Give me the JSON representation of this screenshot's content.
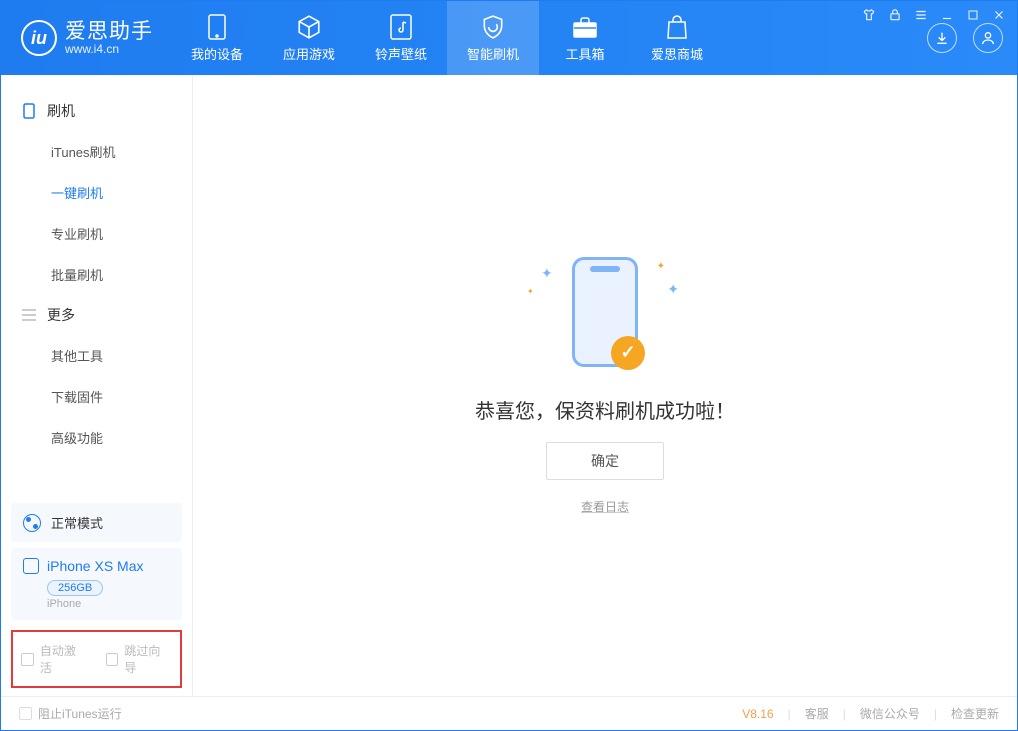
{
  "app": {
    "name_cn": "爱思助手",
    "name_en": "www.i4.cn"
  },
  "tabs": [
    {
      "label": "我的设备"
    },
    {
      "label": "应用游戏"
    },
    {
      "label": "铃声壁纸"
    },
    {
      "label": "智能刷机"
    },
    {
      "label": "工具箱"
    },
    {
      "label": "爱思商城"
    }
  ],
  "sidebar": {
    "group1_title": "刷机",
    "group1_items": [
      {
        "label": "iTunes刷机"
      },
      {
        "label": "一键刷机"
      },
      {
        "label": "专业刷机"
      },
      {
        "label": "批量刷机"
      }
    ],
    "group2_title": "更多",
    "group2_items": [
      {
        "label": "其他工具"
      },
      {
        "label": "下载固件"
      },
      {
        "label": "高级功能"
      }
    ],
    "mode_label": "正常模式",
    "device_name": "iPhone XS Max",
    "device_capacity": "256GB",
    "device_type": "iPhone",
    "opt_auto_activate": "自动激活",
    "opt_skip_guide": "跳过向导"
  },
  "main": {
    "success_text": "恭喜您，保资料刷机成功啦！",
    "ok_button": "确定",
    "view_log": "查看日志"
  },
  "footer": {
    "block_itunes": "阻止iTunes运行",
    "version": "V8.16",
    "links": [
      "客服",
      "微信公众号",
      "检查更新"
    ]
  }
}
